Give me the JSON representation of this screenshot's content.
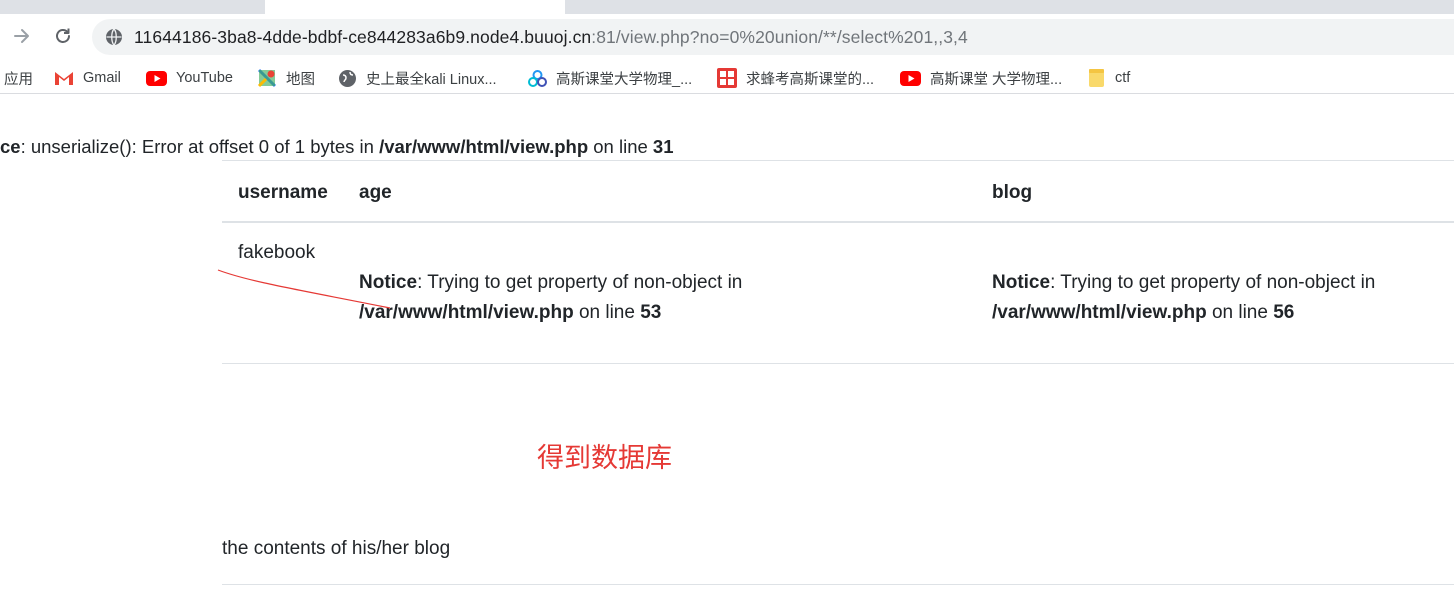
{
  "browser": {
    "url_host": "11644186-3ba8-4dde-bdbf-ce844283a6b9.node4.buuoj.cn",
    "url_path": ":81/view.php?no=0%20union/**/select%201,,3,4",
    "bookmarks": [
      {
        "label": "应用",
        "icon": "apps-icon"
      },
      {
        "label": "Gmail",
        "icon": "gmail-icon"
      },
      {
        "label": "YouTube",
        "icon": "youtube-icon"
      },
      {
        "label": "地图",
        "icon": "maps-icon"
      },
      {
        "label": "史上最全kali Linux...",
        "icon": "globe-icon"
      },
      {
        "label": "高斯课堂大学物理_...",
        "icon": "cloud-icon"
      },
      {
        "label": "求蜂考高斯课堂的...",
        "icon": "seal-icon"
      },
      {
        "label": "高斯课堂 大学物理...",
        "icon": "youtube-icon"
      },
      {
        "label": "ctf",
        "icon": "folder-icon"
      }
    ],
    "colors": {
      "youtube": "#ff0000",
      "folder": "#f9d96b",
      "chrome_bg": "#dee1e6",
      "omnibox_bg": "#f1f3f4"
    }
  },
  "page": {
    "top_notice": {
      "prefix": "ce",
      "message": ": unserialize(): Error at offset 0 of 1 bytes in ",
      "path": "/var/www/html/view.php",
      "on_line": " on line ",
      "line": "31"
    },
    "table": {
      "headers": [
        "username",
        "age",
        "blog"
      ],
      "row": {
        "username": "fakebook",
        "age_notice": {
          "label": "Notice",
          "message": ": Trying to get property of non-object in",
          "path": "/var/www/html/view.php",
          "on_line": " on line ",
          "line": "53"
        },
        "blog_notice": {
          "label": "Notice",
          "message": ": Trying to get property of non-object in",
          "path": "/var/www/html/view.php",
          "on_line": " on line ",
          "line": "56"
        }
      }
    },
    "annotation": "得到数据库",
    "blog_contents": "the contents of his/her blog",
    "annotation_color": "#e53935"
  }
}
